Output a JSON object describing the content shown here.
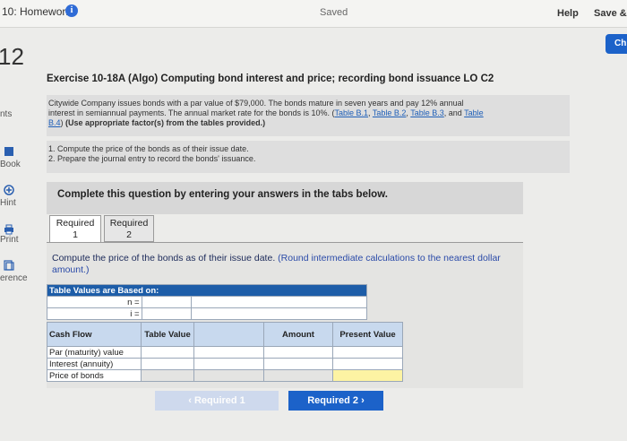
{
  "header": {
    "title": "10: Homework",
    "status": "Saved",
    "help_label": "Help",
    "save_exit_label": "Save &",
    "check_label": "Ch"
  },
  "question_number": "12",
  "sidebar": {
    "items": [
      {
        "label": "nts",
        "icon": "points"
      },
      {
        "label": "Book",
        "icon": "book-icon"
      },
      {
        "label": "Hint",
        "icon": "hint-icon"
      },
      {
        "label": "Print",
        "icon": "print-icon"
      },
      {
        "label": "erence",
        "icon": "reference-icon"
      }
    ]
  },
  "exercise": {
    "title": "Exercise 10-18A (Algo) Computing bond interest and price; recording bond issuance LO C2",
    "body_line1": "Citywide Company issues bonds with a par value of $79,000. The bonds mature in seven years and pay 12% annual",
    "body_line2_prefix": "interest in semiannual payments. The annual market rate for the bonds is 10%. (",
    "link_b1": "Table B.1",
    "link_b2": "Table B.2",
    "link_b3": "Table B.3",
    "and_text": ", and ",
    "link_b4a": "Table",
    "link_b4b": "B.4",
    "paren_close": ")",
    "emph": "(Use appropriate factor(s) from the tables provided.)",
    "task1": "1. Compute the price of the bonds as of their issue date.",
    "task2": "2. Prepare the journal entry to record the bonds' issuance."
  },
  "complete_banner": "Complete this question by entering your answers in the tabs below.",
  "tabs": [
    {
      "line1": "Required",
      "line2": "1"
    },
    {
      "line1": "Required",
      "line2": "2"
    }
  ],
  "instruction": {
    "main": "Compute the price of the bonds as of their issue date.",
    "note": "(Round intermediate calculations to the nearest dollar amount.)"
  },
  "table_values": {
    "header": "Table Values are Based on:",
    "n_label": "n =",
    "i_label": "i ="
  },
  "cash_flow_table": {
    "headers": [
      "Cash Flow",
      "Table Value",
      "Amount",
      "Present Value"
    ],
    "rows": [
      "Par (maturity) value",
      "Interest (annuity)",
      "Price of bonds"
    ]
  },
  "nav": {
    "prev_label": "Required 1",
    "next_label": "Required 2"
  }
}
